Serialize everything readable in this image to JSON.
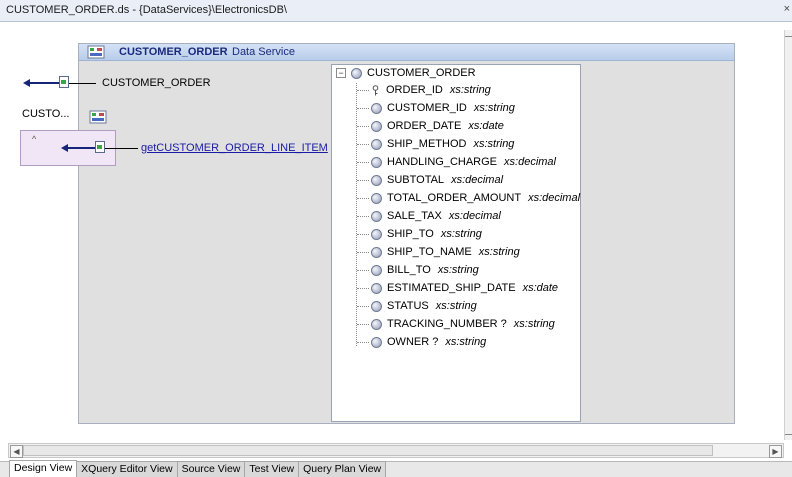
{
  "window": {
    "title": "CUSTOMER_ORDER.ds - {DataServices}\\ElectronicsDB\\",
    "close_glyph": "×"
  },
  "data_service": {
    "name": "CUSTOMER_ORDER",
    "subtitle": "Data Service"
  },
  "operations": {
    "read_function": "CUSTOMER_ORDER",
    "group_label": "CUSTO...",
    "navigation_function": "getCUSTOMER_ORDER_LINE_ITEM"
  },
  "schema_tree": {
    "root": "CUSTOMER_ORDER",
    "fields": [
      {
        "name": "ORDER_ID",
        "type": "xs:string",
        "key": true
      },
      {
        "name": "CUSTOMER_ID",
        "type": "xs:string",
        "key": false
      },
      {
        "name": "ORDER_DATE",
        "type": "xs:date",
        "key": false
      },
      {
        "name": "SHIP_METHOD",
        "type": "xs:string",
        "key": false
      },
      {
        "name": "HANDLING_CHARGE",
        "type": "xs:decimal",
        "key": false
      },
      {
        "name": "SUBTOTAL",
        "type": "xs:decimal",
        "key": false
      },
      {
        "name": "TOTAL_ORDER_AMOUNT",
        "type": "xs:decimal",
        "key": false
      },
      {
        "name": "SALE_TAX",
        "type": "xs:decimal",
        "key": false
      },
      {
        "name": "SHIP_TO",
        "type": "xs:string",
        "key": false
      },
      {
        "name": "SHIP_TO_NAME",
        "type": "xs:string",
        "key": false
      },
      {
        "name": "BILL_TO",
        "type": "xs:string",
        "key": false
      },
      {
        "name": "ESTIMATED_SHIP_DATE",
        "type": "xs:date",
        "key": false
      },
      {
        "name": "STATUS",
        "type": "xs:string",
        "key": false
      },
      {
        "name": "TRACKING_NUMBER ?",
        "type": "xs:string",
        "key": false
      },
      {
        "name": "OWNER ?",
        "type": "xs:string",
        "key": false
      }
    ]
  },
  "tabs": [
    {
      "label": "Design View",
      "active": true
    },
    {
      "label": "XQuery Editor View",
      "active": false
    },
    {
      "label": "Source View",
      "active": false
    },
    {
      "label": "Test View",
      "active": false
    },
    {
      "label": "Query Plan View",
      "active": false
    }
  ],
  "colors": {
    "accent": "#16247a",
    "header_text": "#1a2a7a",
    "link": "#1a1aa8",
    "panel_bg": "#e0e0e0"
  }
}
